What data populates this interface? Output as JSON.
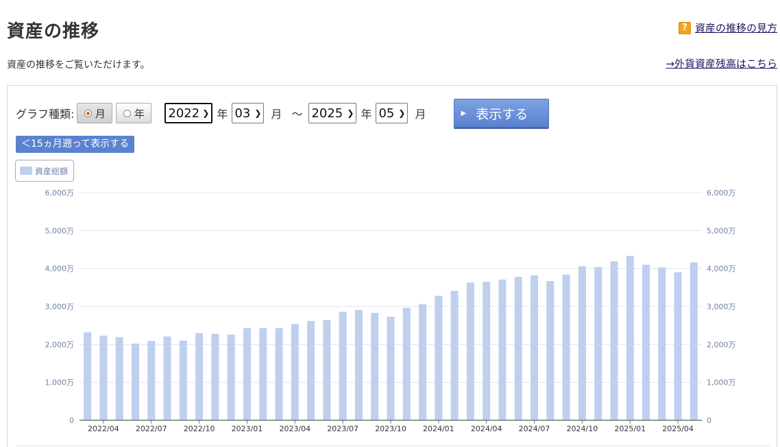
{
  "header": {
    "title": "資産の推移",
    "help_link": "資産の推移の見方",
    "help_icon": "question-icon",
    "description": "資産の推移をご覧いただけます。",
    "fx_link": "→外貨資産残高はこちら"
  },
  "controls": {
    "graph_type_label": "グラフ種類:",
    "radio_month": "月",
    "radio_year": "年",
    "selected_type": "月",
    "from_year": "2022",
    "from_month": "03",
    "to_year": "2025",
    "to_month": "05",
    "year_unit": "年",
    "month_unit": "月",
    "tilde": "～",
    "show_button": "表示する",
    "back_button": "＜15ヵ月遡って表示する"
  },
  "colors": {
    "bar": "#bed0ee",
    "button": "#5a82cf",
    "axis_text": "#7080a6"
  },
  "chart_data": {
    "type": "bar",
    "legend": "資産総額",
    "legend_position": "top-left",
    "grid": true,
    "ylim": [
      0,
      6000
    ],
    "y_unit": "万",
    "y_ticks": [
      "0",
      "1,000万",
      "2,000万",
      "3,000万",
      "4,000万",
      "5,000万",
      "6,000万"
    ],
    "x_tick_labels": [
      "2022/04",
      "2022/07",
      "2022/10",
      "2023/01",
      "2023/04",
      "2023/07",
      "2023/10",
      "2024/01",
      "2024/04",
      "2024/07",
      "2024/10",
      "2025/01",
      "2025/04"
    ],
    "categories": [
      "2022/03",
      "2022/04",
      "2022/05",
      "2022/06",
      "2022/07",
      "2022/08",
      "2022/09",
      "2022/10",
      "2022/11",
      "2022/12",
      "2023/01",
      "2023/02",
      "2023/03",
      "2023/04",
      "2023/05",
      "2023/06",
      "2023/07",
      "2023/08",
      "2023/09",
      "2023/10",
      "2023/11",
      "2023/12",
      "2024/01",
      "2024/02",
      "2024/03",
      "2024/04",
      "2024/05",
      "2024/06",
      "2024/07",
      "2024/08",
      "2024/09",
      "2024/10",
      "2024/11",
      "2024/12",
      "2025/01",
      "2025/02",
      "2025/03",
      "2025/04",
      "2025/05"
    ],
    "series": [
      {
        "name": "資産総額",
        "values": [
          2320,
          2230,
          2190,
          2020,
          2090,
          2210,
          2100,
          2300,
          2280,
          2260,
          2430,
          2430,
          2430,
          2540,
          2620,
          2640,
          2860,
          2910,
          2830,
          2730,
          2960,
          3060,
          3280,
          3410,
          3630,
          3650,
          3710,
          3780,
          3820,
          3670,
          3840,
          4060,
          4040,
          4190,
          4330,
          4100,
          4030,
          3900,
          4160
        ]
      }
    ]
  }
}
